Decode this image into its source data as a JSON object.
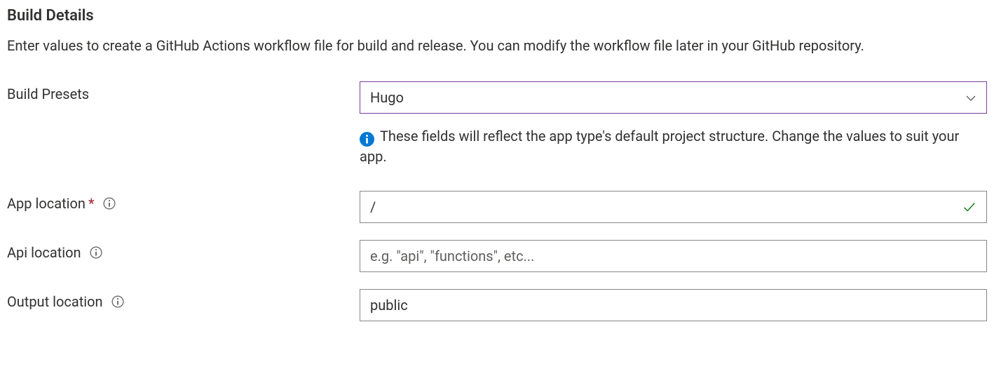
{
  "section": {
    "title": "Build Details",
    "description": "Enter values to create a GitHub Actions workflow file for build and release. You can modify the workflow file later in your GitHub repository."
  },
  "fields": {
    "buildPresets": {
      "label": "Build Presets",
      "value": "Hugo",
      "hint": "These fields will reflect the app type's default project structure. Change the values to suit your app."
    },
    "appLocation": {
      "label": "App location",
      "required": true,
      "value": "/",
      "valid": true
    },
    "apiLocation": {
      "label": "Api location",
      "value": "",
      "placeholder": "e.g. \"api\", \"functions\", etc..."
    },
    "outputLocation": {
      "label": "Output location",
      "value": "public"
    }
  }
}
